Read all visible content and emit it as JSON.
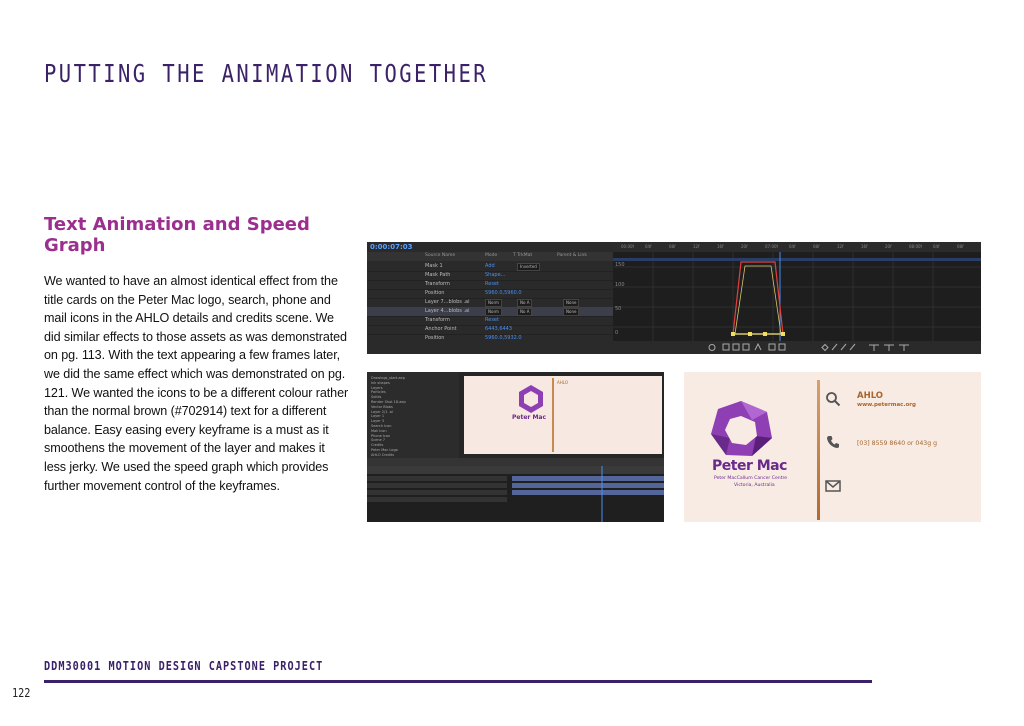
{
  "page": {
    "title": "PUTTING THE ANIMATION TOGETHER",
    "section_heading": "Text Animation and Speed Graph",
    "body": "We wanted to have an almost identical effect from the title cards on the Peter Mac logo, search, phone and mail icons in the AHLO details and credits scene. We did similar effects to those assets as was demonstrated on pg. 113. With the text appearing a few frames later, we did the same effect which was demonstrated on pg. 121. We wanted the icons to be a different colour rather than the normal brown (#702914) text for a different balance. Easy easing every keyframe is a must as it smoothens the movement of the layer and makes it less jerky. We used the speed graph which provides further movement control of the keyframes.",
    "footer_label": "DDM30001 MOTION DESIGN CAPSTONE PROJECT",
    "page_number": "122"
  },
  "colors": {
    "title": "#3a2168",
    "heading": "#9b2f8f",
    "brand_purple": "#6a2a8a",
    "brand_brown": "#a6662e",
    "ae_blue": "#4a8ef0"
  },
  "timeline_screenshot": {
    "timecode": "0:00:07:03",
    "columns": [
      "Source Name",
      "Mode",
      "T TrkMat",
      "Parent & Link"
    ],
    "rows": [
      {
        "label": "Mask 1",
        "value": "Add",
        "mode_a": "",
        "mode_b": "Inverted"
      },
      {
        "label": "Mask Path",
        "value": "Shape..."
      },
      {
        "label": "Transform",
        "value": "Reset"
      },
      {
        "label": "Position",
        "value": "5960.0,5960.0"
      },
      {
        "label": "Layer 7...blobs .ai",
        "value": "",
        "mode_a": "Norm",
        "mode_b": "No A",
        "mode_c": "None"
      },
      {
        "label": "Layer 4...blobs .ai",
        "value": "",
        "mode_a": "Norm",
        "mode_b": "No A",
        "mode_c": "None"
      },
      {
        "label": "Transform",
        "value": "Reset"
      },
      {
        "label": "Anchor Point",
        "value": "6443,6443"
      },
      {
        "label": "Position",
        "value": "5960.0,5932.0"
      },
      {
        "label": "Scale",
        "value": "0.0 , 0.0%"
      },
      {
        "label": "Rotation",
        "value": "0x+0.0°"
      },
      {
        "label": "Opacity",
        "value": "100%"
      }
    ],
    "ruler": [
      "00:00f",
      "04f",
      "08f",
      "12f",
      "16f",
      "20f",
      "07:00f",
      "04f",
      "08f",
      "12f",
      "16f",
      "20f",
      "08:00f",
      "04f",
      "08f"
    ],
    "graph_labels": [
      "150",
      "100",
      "50",
      "0"
    ]
  },
  "comp_screenshot": {
    "viewer_brand": "Peter Mac",
    "viewer_ahlo": "AHLO",
    "project_items": [
      "Drawings_start.aep",
      "Ink shapes",
      "Layers",
      "Particles",
      "Solids",
      "Render Shot 18.aep",
      "Vector Blobs",
      "Layer 2/1 .ai",
      "Layer 1",
      "Layer 3",
      "Search Icon",
      "Mail Icon",
      "Phone Icon",
      "Scene 7",
      "Credits",
      "Peter Mac Logo",
      "AHLO Credits"
    ]
  },
  "credits_frame": {
    "brand": "Peter Mac",
    "centre_name": "Peter MacCallum Cancer Centre",
    "location": "Victoria, Australia",
    "ahlo_title": "AHLO",
    "url": "www.petermac.org",
    "phone": "[03] 8559 8640 or 043g g"
  }
}
